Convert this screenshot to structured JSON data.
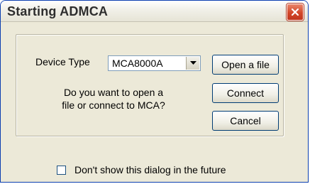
{
  "window": {
    "title": "Starting ADMCA"
  },
  "form": {
    "device_type_label": "Device Type",
    "device_type_value": "MCA8000A",
    "question_line1": "Do you want to open a",
    "question_line2": "file or connect to MCA?"
  },
  "buttons": {
    "open_file": "Open a file",
    "connect": "Connect",
    "cancel": "Cancel"
  },
  "footer": {
    "checkbox_label": "Don't show this dialog in the future",
    "checkbox_checked": false
  },
  "colors": {
    "close_button": "#d2472a",
    "window_border": "#0b3fb0",
    "dialog_background": "#ece9d8"
  },
  "icons": {
    "close": "close-icon",
    "dropdown": "chevron-down-icon"
  }
}
